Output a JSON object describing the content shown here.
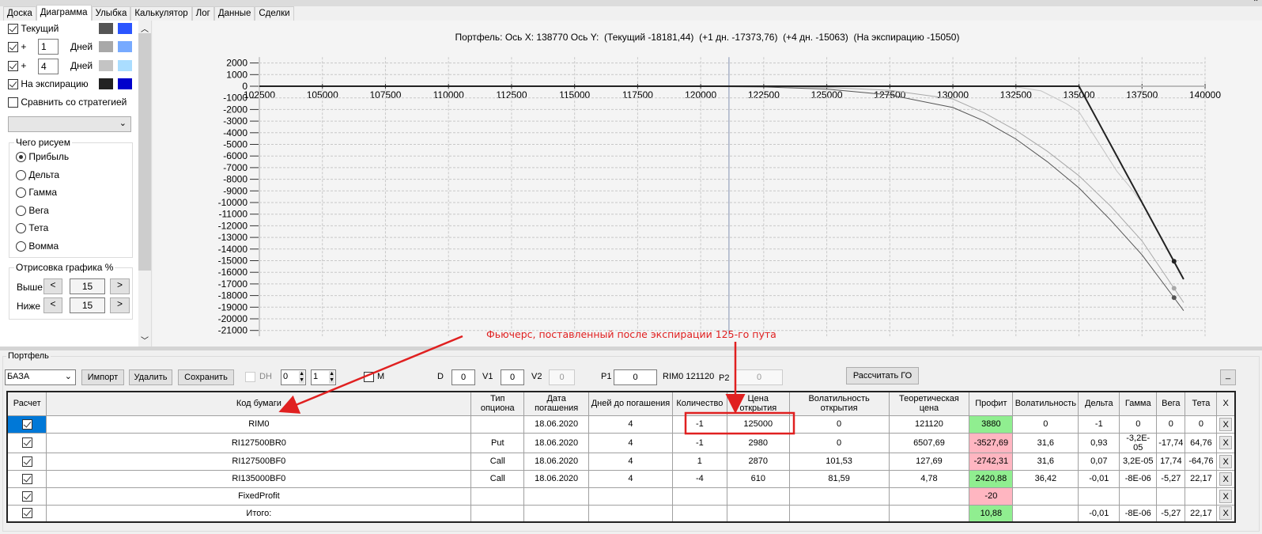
{
  "tabs": [
    "Доска",
    "Диаграмма",
    "Улыбка",
    "Калькулятор",
    "Лог",
    "Данные",
    "Сделки"
  ],
  "active_tab": 1,
  "left": {
    "current_label": "Текущий",
    "plus": "+",
    "days_label": "Дней",
    "day1": "1",
    "day2": "4",
    "expiration_label": "На экспирацию",
    "compare_label": "Сравнить со стратегией",
    "draw_group": "Чего рисуем",
    "radios": [
      "Прибыль",
      "Дельта",
      "Гамма",
      "Вега",
      "Тета",
      "Вомма"
    ],
    "range_group": "Отрисовка графика %",
    "above_label": "Выше",
    "below_label": "Ниже",
    "above": "15",
    "below": "15",
    "lt": "<",
    "gt": ">",
    "colors": {
      "current": [
        "#555555",
        "#2b55ff"
      ],
      "d1": [
        "#a8a8a8",
        "#77aaff"
      ],
      "d4": [
        "#c4c4c4",
        "#aaddff"
      ],
      "exp": [
        "#222222",
        "#0000cc"
      ]
    }
  },
  "chart_data": {
    "type": "line",
    "title": "Портфель: Ось X: 138770 Ось Y:  (Текущий -18181,44)  (+1 дн. -17373,76)  (+4 дн. -15063)  (На экспирацию -15050)",
    "xlim": [
      102500,
      140000
    ],
    "ylim": [
      -21500,
      2500
    ],
    "xticks": [
      102500,
      105000,
      107500,
      110000,
      112500,
      115000,
      117500,
      120000,
      122500,
      125000,
      127500,
      130000,
      132500,
      135000,
      137500,
      140000
    ],
    "yticks": [
      2000,
      1000,
      0,
      -1000,
      -2000,
      -3000,
      -4000,
      -5000,
      -6000,
      -7000,
      -8000,
      -9000,
      -10000,
      -11000,
      -12000,
      -13000,
      -14000,
      -15000,
      -16000,
      -17000,
      -18000,
      -19000,
      -20000,
      -21000
    ],
    "current_price": 121120,
    "cursor_x": 138770,
    "series": [
      {
        "name": "Текущий",
        "color": "#555555",
        "width": 1,
        "marker": -18181.44,
        "points": [
          [
            102500,
            0
          ],
          [
            120000,
            -20
          ],
          [
            122500,
            -60
          ],
          [
            125000,
            -250
          ],
          [
            127500,
            -750
          ],
          [
            130000,
            -1830
          ],
          [
            131250,
            -3000
          ],
          [
            132500,
            -4540
          ],
          [
            133750,
            -6500
          ],
          [
            135000,
            -8740
          ],
          [
            136250,
            -11500
          ],
          [
            137500,
            -14500
          ],
          [
            138770,
            -18181
          ],
          [
            139150,
            -19300
          ]
        ]
      },
      {
        "name": "+1 дн.",
        "color": "#a8a8a8",
        "width": 1,
        "marker": -17373.76,
        "points": [
          [
            102500,
            0
          ],
          [
            122500,
            -20
          ],
          [
            125000,
            -100
          ],
          [
            127500,
            -350
          ],
          [
            130000,
            -1100
          ],
          [
            131250,
            -2300
          ],
          [
            132500,
            -3800
          ],
          [
            133750,
            -5600
          ],
          [
            135000,
            -7700
          ],
          [
            136250,
            -10300
          ],
          [
            137500,
            -13300
          ],
          [
            138770,
            -17374
          ],
          [
            139150,
            -18600
          ]
        ]
      },
      {
        "name": "+4 дн.",
        "color": "#c4c4c4",
        "width": 1,
        "marker": -15063,
        "points": [
          [
            102500,
            0
          ],
          [
            132000,
            0
          ],
          [
            132500,
            -50
          ],
          [
            133500,
            -400
          ],
          [
            134500,
            -1500
          ],
          [
            135000,
            -2200
          ],
          [
            135500,
            -3900
          ],
          [
            136000,
            -5600
          ],
          [
            136500,
            -7300
          ],
          [
            137000,
            -8600
          ],
          [
            137500,
            -10050
          ],
          [
            138770,
            -15063
          ]
        ]
      },
      {
        "name": "На экспирацию",
        "color": "#222222",
        "width": 2,
        "marker": -15050,
        "points": [
          [
            102500,
            0
          ],
          [
            135000,
            0
          ],
          [
            139150,
            -16600
          ]
        ]
      }
    ]
  },
  "annotation": {
    "text": "Фьючерс, поставленный после экспирации 125-го пута",
    "color": "#e02020"
  },
  "portfolio": {
    "title": "Портфель",
    "select": "БАЗА",
    "import": "Импорт",
    "delete": "Удалить",
    "save": "Сохранить",
    "dh": "DH",
    "spin1": "0",
    "spin2": "1",
    "m": "M",
    "d_label": "D",
    "d": "0",
    "v1_label": "V1",
    "v1": "0",
    "v2_label": "V2",
    "v2": "0",
    "p1_label": "P1",
    "p1": "0",
    "rim": "RIM0 121120",
    "p2_label": "P2",
    "p2": "0",
    "calc_go": "Рассчитать ГО",
    "min": "_"
  },
  "table": {
    "headers": [
      "Расчет",
      "Код бумаги",
      "Тип опциона",
      "Дата погашения",
      "Дней до погашения",
      "Количество",
      "Цена открытия",
      "Волатильность открытия",
      "Теоретическая цена",
      "Профит",
      "Волатильность",
      "Дельта",
      "Гамма",
      "Вега",
      "Тета",
      "X"
    ],
    "rows": [
      [
        "",
        "RIM0",
        "",
        "18.06.2020",
        "4",
        "-1",
        "125000",
        "0",
        "121120",
        "3880",
        "0",
        "-1",
        "0",
        "0",
        "0",
        "X"
      ],
      [
        "",
        "RI127500BR0",
        "Put",
        "18.06.2020",
        "4",
        "-1",
        "2980",
        "0",
        "6507,69",
        "-3527,69",
        "31,6",
        "0,93",
        "-3,2E-05",
        "-17,74",
        "64,76",
        "X"
      ],
      [
        "",
        "RI127500BF0",
        "Call",
        "18.06.2020",
        "4",
        "1",
        "2870",
        "101,53",
        "127,69",
        "-2742,31",
        "31,6",
        "0,07",
        "3,2E-05",
        "17,74",
        "-64,76",
        "X"
      ],
      [
        "",
        "RI135000BF0",
        "Call",
        "18.06.2020",
        "4",
        "-4",
        "610",
        "81,59",
        "4,78",
        "2420,88",
        "36,42",
        "-0,01",
        "-8E-06",
        "-5,27",
        "22,17",
        "X"
      ],
      [
        "",
        "FixedProfit",
        "",
        "",
        "",
        "",
        "",
        "",
        "",
        "-20",
        "",
        "",
        "",
        "",
        "",
        "X"
      ],
      [
        "",
        "Итого:",
        "",
        "",
        "",
        "",
        "",
        "",
        "",
        "10,88",
        "",
        "-0,01",
        "-8E-06",
        "-5,27",
        "22,17",
        "X"
      ]
    ],
    "profit_colors": [
      "green",
      "red",
      "red",
      "green",
      "red",
      "green"
    ]
  }
}
